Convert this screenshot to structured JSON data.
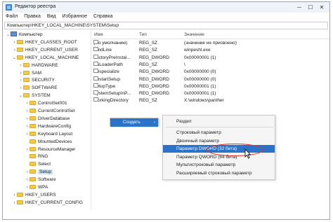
{
  "window": {
    "title": "Редактор реестра",
    "buttons": [
      "─",
      "☐",
      "✕"
    ]
  },
  "menu": [
    "Файл",
    "Правка",
    "Вид",
    "Избранное",
    "Справка"
  ],
  "address": "Компьютер\\HKEY_LOCAL_MACHINE\\SYSTEM\\Setup",
  "tree": [
    {
      "label": "Компьютер",
      "toggle": "⌄",
      "icon": "pc"
    },
    {
      "label": "HKEY_CLASSES_ROOT",
      "toggle": "›",
      "icon": "folder"
    },
    {
      "label": "HKEY_CURRENT_USER",
      "toggle": "›",
      "icon": "folder"
    },
    {
      "label": "HKEY_LOCAL_MACHINE",
      "toggle": "⌄",
      "icon": "folder"
    },
    {
      "label": "HARDWARE",
      "toggle": "›",
      "icon": "folder"
    },
    {
      "label": "SAM",
      "toggle": "›",
      "icon": "folder"
    },
    {
      "label": "SECURITY",
      "toggle": "›",
      "icon": "folder"
    },
    {
      "label": "SOFTWARE",
      "toggle": "›",
      "icon": "folder"
    },
    {
      "label": "SYSTEM",
      "toggle": "⌄",
      "icon": "folder"
    },
    {
      "label": "ControlSet001",
      "toggle": "›",
      "icon": "folder"
    },
    {
      "label": "CurrentControlSet",
      "toggle": "›",
      "icon": "folder"
    },
    {
      "label": "DriverDatabase",
      "toggle": "›",
      "icon": "folder"
    },
    {
      "label": "HardwareConfig",
      "toggle": "›",
      "icon": "folder"
    },
    {
      "label": "Keyboard Layout",
      "toggle": "›",
      "icon": "folder"
    },
    {
      "label": "MountedDevices",
      "toggle": "",
      "icon": "folder"
    },
    {
      "label": "ResourceManager",
      "toggle": "›",
      "icon": "folder"
    },
    {
      "label": "RNG",
      "toggle": "",
      "icon": "folder"
    },
    {
      "label": "Select",
      "toggle": "",
      "icon": "folder"
    },
    {
      "label": "Setup",
      "toggle": "›",
      "icon": "folder",
      "selected": true
    },
    {
      "label": "Software",
      "toggle": "›",
      "icon": "folder"
    },
    {
      "label": "WPA",
      "toggle": "›",
      "icon": "folder"
    },
    {
      "label": "HKEY_USERS",
      "toggle": "›",
      "icon": "folder"
    },
    {
      "label": "HKEY_CURRENT_CONFIG",
      "toggle": "›",
      "icon": "folder"
    }
  ],
  "columns": {
    "name": "Имя",
    "type": "Тип",
    "value": "Значение"
  },
  "values": [
    {
      "name": "(По умолчанию)",
      "type": "REG_SZ",
      "value": "(значение не присвоено)",
      "kind": "ab"
    },
    {
      "name": "CmdLine",
      "type": "REG_SZ",
      "value": "winpeshl.exe",
      "kind": "ab"
    },
    {
      "name": "FactoryPreInstal...",
      "type": "REG_DWORD",
      "value": "0x00000001 (1)",
      "kind": "bin"
    },
    {
      "name": "OsLoaderPath",
      "type": "REG_SZ",
      "value": "\\",
      "kind": "ab"
    },
    {
      "name": "Respecialize",
      "type": "REG_DWORD",
      "value": "0x00000000 (0)",
      "kind": "bin"
    },
    {
      "name": "RestartSetup",
      "type": "REG_DWORD",
      "value": "0x00000000 (0)",
      "kind": "bin"
    },
    {
      "name": "SetupType",
      "type": "REG_DWORD",
      "value": "0x00000001 (1)",
      "kind": "bin"
    },
    {
      "name": "SystemSetupInP...",
      "type": "REG_DWORD",
      "value": "0x00000001 (1)",
      "kind": "bin"
    },
    {
      "name": "WorkingDirectory",
      "type": "REG_SZ",
      "value": "X:\\windows\\panther",
      "kind": "ab"
    }
  ],
  "context_menu": {
    "create": "Создать",
    "arrow": "›"
  },
  "submenu": {
    "section": "Раздел",
    "items": [
      {
        "label": "Строковый параметр",
        "highlighted": false
      },
      {
        "label": "Двоичный параметр",
        "highlighted": false
      },
      {
        "label": "Параметр DWORD (32 бита)",
        "highlighted": true
      },
      {
        "label": "Параметр QWORD (64 бита)",
        "highlighted": false
      },
      {
        "label": "Мультистроковый параметр",
        "highlighted": false
      },
      {
        "label": "Расширяемый строковый параметр",
        "highlighted": false
      }
    ]
  },
  "colors": {
    "accent": "#2a73c8",
    "annotation": "#e0322c",
    "folder": "#f2c94c"
  }
}
